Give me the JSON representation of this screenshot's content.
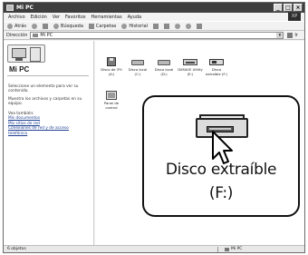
{
  "window": {
    "title": "Mi PC",
    "buttons": {
      "minimize": "_",
      "maximize": "□",
      "close": "×"
    },
    "brand": "XP"
  },
  "menu": [
    "Archivo",
    "Edición",
    "Ver",
    "Favoritos",
    "Herramientas",
    "Ayuda"
  ],
  "toolbar": {
    "back": "Atrás",
    "search": "Búsqueda",
    "folders": "Carpetas",
    "history": "Historial"
  },
  "address": {
    "label": "Dirección",
    "value": "Mi PC",
    "go": "Ir"
  },
  "left_pane": {
    "title": "Mi PC",
    "text1": "Seleccione un elemento para ver su contenido.",
    "text2": "Muestra los archivos y carpetas en su equipo.",
    "see_also": "Vea también:",
    "links": [
      "Mis documentos",
      "Mis sitios de red",
      "Conexiones de red y de acceso telefónico"
    ]
  },
  "drives": [
    {
      "label": "Disco de 3½ (A:)",
      "icon": "floppy-icon"
    },
    {
      "label": "Disco local (C:)",
      "icon": "hard-disk-icon"
    },
    {
      "label": "Disco local (D:)",
      "icon": "hard-disk-icon"
    },
    {
      "label": "DiMAGE Utility (E:)",
      "icon": "dvd-drive-icon"
    },
    {
      "label": "Disco extraíble (F:)",
      "icon": "removable-drive-icon"
    },
    {
      "label": "Panel de control",
      "icon": "control-panel-icon"
    }
  ],
  "callout": {
    "line1": "Disco extraíble",
    "line2": "(F:)"
  },
  "status": {
    "left": "6 objetos",
    "right": "Mi PC"
  }
}
